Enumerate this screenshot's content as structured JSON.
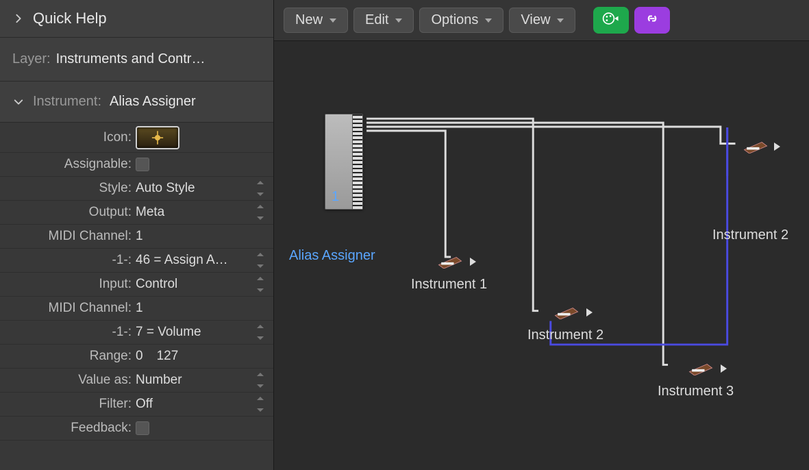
{
  "sidebar": {
    "quick_help_title": "Quick Help",
    "layer_label": "Layer:",
    "layer_value": "Instruments and Contr…",
    "instrument_label": "Instrument:",
    "instrument_value": "Alias Assigner",
    "props": {
      "icon_label": "Icon:",
      "assignable_label": "Assignable:",
      "style_label": "Style:",
      "style_value": "Auto Style",
      "output_label": "Output:",
      "output_value": "Meta",
      "midi_channel_out_label": "MIDI Channel:",
      "midi_channel_out_value": "1",
      "neg1_out_label": "-1-:",
      "neg1_out_value": "46 = Assign A…",
      "input_label": "Input:",
      "input_value": "Control",
      "midi_channel_in_label": "MIDI Channel:",
      "midi_channel_in_value": "1",
      "neg1_in_label": "-1-:",
      "neg1_in_value": "7 = Volume",
      "range_label": "Range:",
      "range_low": "0",
      "range_high": "127",
      "value_as_label": "Value as:",
      "value_as_value": "Number",
      "filter_label": "Filter:",
      "filter_value": "Off",
      "feedback_label": "Feedback:"
    }
  },
  "toolbar": {
    "new_label": "New",
    "edit_label": "Edit",
    "options_label": "Options",
    "view_label": "View"
  },
  "canvas": {
    "assigner_label": "Alias Assigner",
    "assigner_slot": "1",
    "instrument1": "Instrument 1",
    "instrument2a": "Instrument 2",
    "instrument2b": "Instrument 2",
    "instrument3": "Instrument 3"
  }
}
